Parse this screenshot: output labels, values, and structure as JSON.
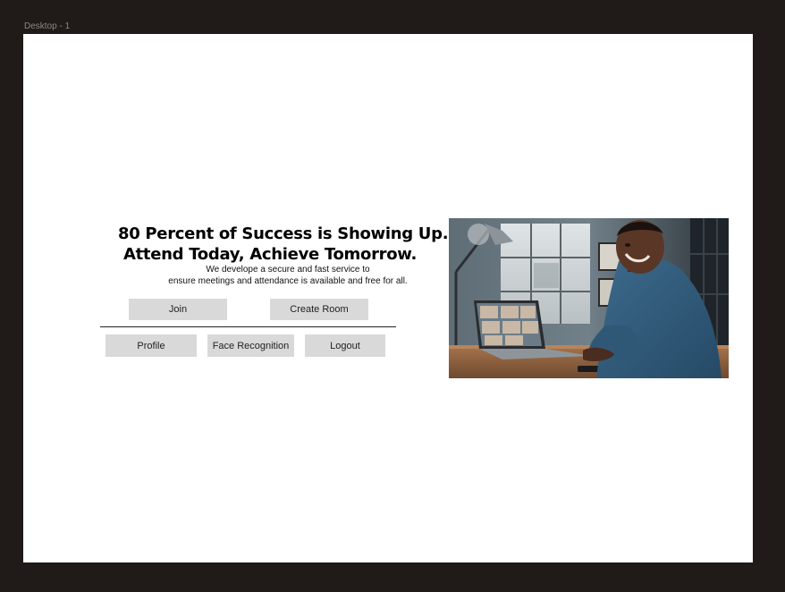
{
  "canvas": {
    "frame_label": "Desktop - 1"
  },
  "hero": {
    "headline_line1": "80 Percent of Success is Showing Up.",
    "headline_line2": "Attend Today, Achieve Tomorrow.",
    "subtext_line1": "We develope a secure and fast service to",
    "subtext_line2": "ensure meetings and attendance is available and free for all."
  },
  "buttons": {
    "join": "Join",
    "create_room": "Create Room",
    "profile": "Profile",
    "face_recognition": "Face Recognition",
    "logout": "Logout"
  },
  "image": {
    "icon": "man-on-video-call-photo"
  },
  "colors": {
    "background": "#201a18",
    "frame": "#ffffff",
    "button": "#d9d9d9"
  }
}
